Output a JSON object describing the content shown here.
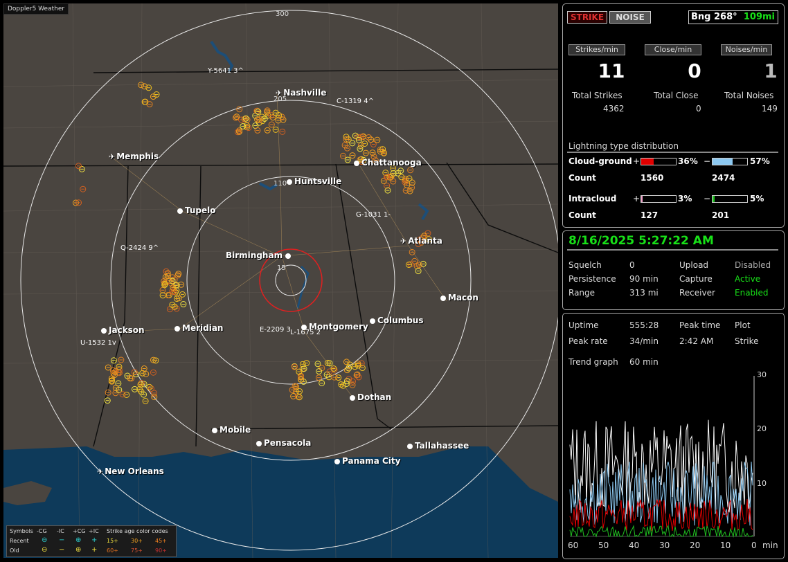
{
  "app": {
    "brand": "Doppler5 Weather"
  },
  "map": {
    "ring_labels": [
      "300",
      "205",
      "110",
      "15"
    ],
    "cities": [
      {
        "name": "Nashville",
        "kind": "airport"
      },
      {
        "name": "Memphis",
        "kind": "airport"
      },
      {
        "name": "Huntsville",
        "kind": "city"
      },
      {
        "name": "Chattanooga",
        "kind": "city"
      },
      {
        "name": "Tupelo",
        "kind": "city"
      },
      {
        "name": "Atlanta",
        "kind": "airport"
      },
      {
        "name": "Birmingham",
        "kind": "city"
      },
      {
        "name": "Macon",
        "kind": "city"
      },
      {
        "name": "Jackson",
        "kind": "city"
      },
      {
        "name": "Meridian",
        "kind": "city"
      },
      {
        "name": "Montgomery",
        "kind": "city"
      },
      {
        "name": "Columbus",
        "kind": "city"
      },
      {
        "name": "Dothan",
        "kind": "city"
      },
      {
        "name": "Mobile",
        "kind": "city"
      },
      {
        "name": "Pensacola",
        "kind": "city"
      },
      {
        "name": "Tallahassee",
        "kind": "city"
      },
      {
        "name": "Panama City",
        "kind": "city"
      },
      {
        "name": "New Orleans",
        "kind": "airport"
      }
    ],
    "tracks": [
      "Y-5641 3^",
      "C-1319 4^",
      "G-1031 1-",
      "Q-2424 9^",
      "E-2209 3",
      "L-1675 2",
      "U-1532 1v"
    ],
    "legend": {
      "title": "Symbols",
      "cols": [
        "-CG",
        "-IC",
        "+CG",
        "+IC"
      ],
      "age_title": "Strike age color codes",
      "rows": [
        {
          "label": "Recent",
          "ages": [
            "15+",
            "30+",
            "45+"
          ]
        },
        {
          "label": "Old",
          "ages": [
            "60+",
            "75+",
            "90+"
          ]
        }
      ]
    }
  },
  "status": {
    "strike_button": "STRIKE",
    "noise_button": "NOISE",
    "bearing": "Bng 268°",
    "distance": "109mi",
    "headers": [
      "Strikes/min",
      "Close/min",
      "Noises/min"
    ],
    "rates": [
      "11",
      "0",
      "1"
    ],
    "total_labels": [
      "Total Strikes",
      "Total Close",
      "Total Noises"
    ],
    "totals": [
      "4362",
      "0",
      "149"
    ],
    "dist_title": "Lightning type distribution",
    "cg_label": "Cloud-ground",
    "ic_label": "Intracloud",
    "count_label": "Count",
    "plus": "+",
    "minus": "−",
    "cg_pos_pct": "36%",
    "cg_neg_pct": "57%",
    "ic_pos_pct": "3%",
    "ic_neg_pct": "5%",
    "cg_pos_count": "1560",
    "cg_neg_count": "2474",
    "ic_pos_count": "127",
    "ic_neg_count": "201",
    "cg_pos_frac": 0.36,
    "cg_neg_frac": 0.57,
    "ic_pos_frac": 0.03,
    "ic_neg_frac": 0.05
  },
  "settings": {
    "datetime": "8/16/2025 5:27:22 AM",
    "squelch_label": "Squelch",
    "squelch": "0",
    "persistence_label": "Persistence",
    "persistence": "90 min",
    "range_label": "Range",
    "range": "313 mi",
    "upload_label": "Upload",
    "upload": "Disabled",
    "capture_label": "Capture",
    "capture": "Active",
    "receiver_label": "Receiver",
    "receiver": "Enabled"
  },
  "trend": {
    "uptime_label": "Uptime",
    "uptime": "555:28",
    "peak_time_label": "Peak time",
    "plot_label": "Plot",
    "peak_rate_label": "Peak rate",
    "peak_rate": "34/min",
    "peak_time": "2:42 AM",
    "plot": "Strike",
    "trend_label": "Trend graph",
    "trend_window": "60 min",
    "x_ticks": [
      "60",
      "50",
      "40",
      "30",
      "20",
      "10",
      "0"
    ],
    "x_unit": "min",
    "y_ticks": [
      "30",
      "20",
      "10"
    ]
  },
  "colors": {
    "accent_green": "#18e018",
    "strike_red": "#e03030",
    "cg_pos": "#e00000",
    "cg_neg": "#8cc8f0",
    "ic_pos": "#f0a0c8",
    "ic_neg": "#20c020"
  }
}
